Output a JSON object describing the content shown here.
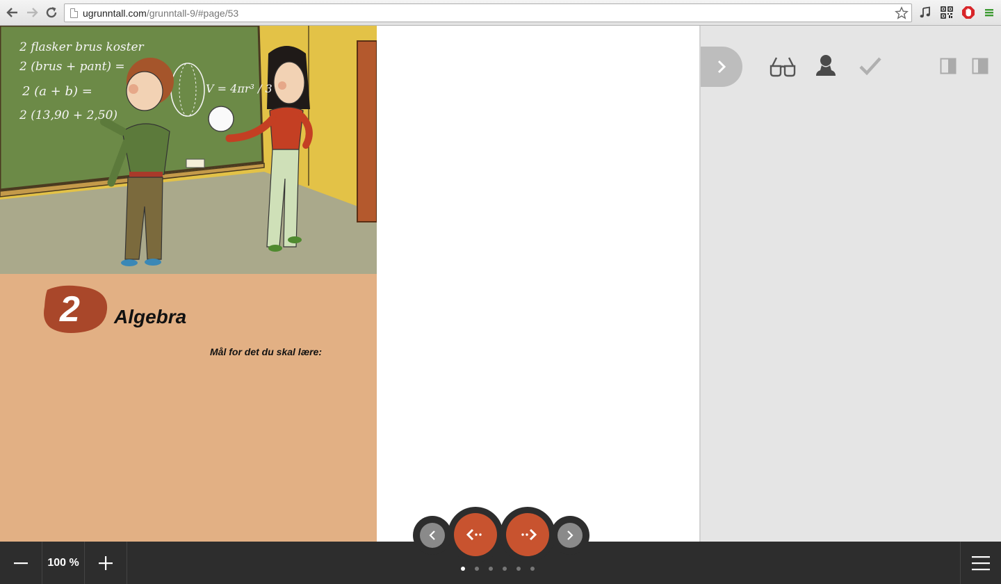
{
  "browser": {
    "url_host": "ugrunntall.com",
    "url_path": "/grunntall-9/#page/53",
    "icons": [
      "back-icon",
      "forward-icon",
      "reload-icon",
      "page-icon",
      "bookmark-star-icon",
      "music-note-icon",
      "qr-code-icon",
      "adblock-icon",
      "chrome-menu-icon"
    ]
  },
  "book": {
    "chapter_number": "2",
    "chapter_title": "Algebra",
    "goals_heading": "Mål for det du skal lære:",
    "chalkboard": {
      "line1": "2 flasker brus koster",
      "line2": "2 (brus + pant) =",
      "line3": "2  (a + b) =",
      "line4": "2 (13,90 + 2,50)",
      "formula": "V = 4πr³ / 3"
    },
    "colors": {
      "page": "#e2b084",
      "accent": "#c8532f",
      "chapter_blob": "#a9472a"
    }
  },
  "side_panel": {
    "icons": [
      "collapse-chevron-icon",
      "glasses-icon",
      "user-icon",
      "checkmark-icon",
      "single-page-view-icon",
      "double-page-view-icon"
    ]
  },
  "toolbar": {
    "zoom_out_icon": "minus-icon",
    "zoom_level": "100 %",
    "zoom_in_icon": "plus-icon",
    "menu_icon": "hamburger-icon",
    "page_dots_count": 6,
    "active_dot": 0
  },
  "pager": {
    "icons": [
      "prev-page-icon",
      "prev-spread-icon",
      "next-spread-icon",
      "next-page-icon"
    ]
  }
}
